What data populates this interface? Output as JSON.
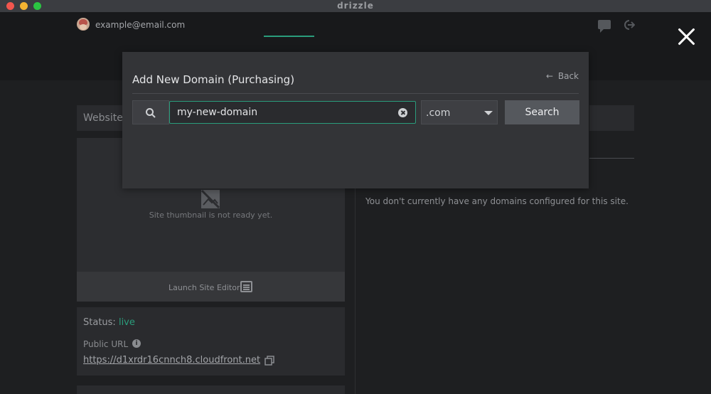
{
  "window": {
    "app_title": "drizzle"
  },
  "header": {
    "user_email": "example@email.com",
    "icons": {
      "chat": "chat-icon",
      "logout": "logout-icon",
      "close": "close-icon"
    }
  },
  "site": {
    "website_heading": "Website",
    "thumbnail_text": "Site thumbnail is not ready yet.",
    "launch_editor_label": "Launch Site Editor",
    "status_label": "Status:",
    "status_value": "live",
    "public_url_label": "Public URL",
    "public_url": "https://d1xrdr16cnnch8.cloudfront.net"
  },
  "domains": {
    "empty_message": "You don't currently have any domains configured for this site."
  },
  "modal": {
    "title": "Add New Domain (Purchasing)",
    "back_label": "Back",
    "domain_input_value": "my-new-domain",
    "tld_selected": ".com",
    "search_label": "Search"
  },
  "colors": {
    "accent": "#2a9d7c",
    "modal_bg": "#333437",
    "page_bg": "#1e1f21"
  }
}
